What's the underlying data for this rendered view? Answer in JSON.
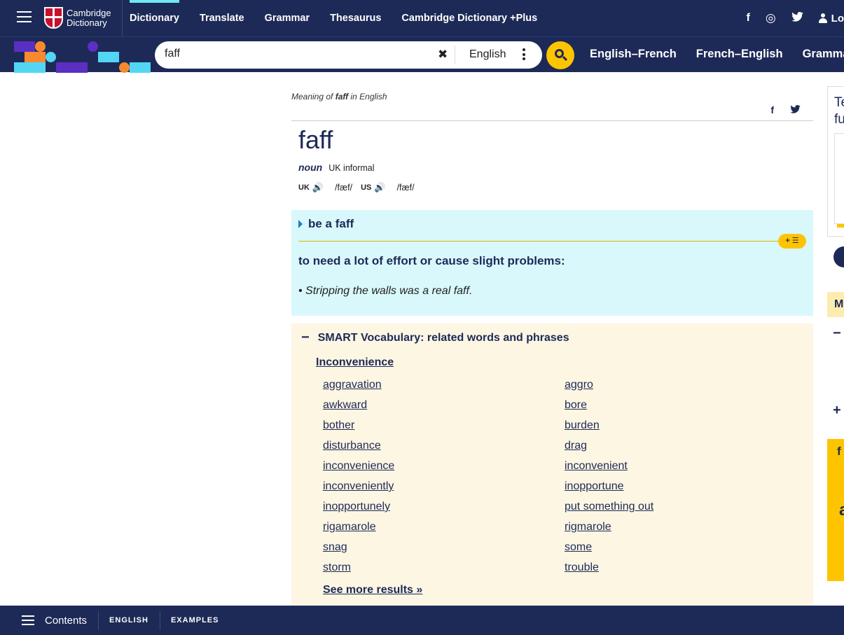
{
  "header": {
    "logo_line1": "Cambridge",
    "logo_line2": "Dictionary",
    "nav": [
      "Dictionary",
      "Translate",
      "Grammar",
      "Thesaurus",
      "Cambridge Dictionary +Plus"
    ],
    "social": [
      "f",
      "◎",
      "🐦"
    ],
    "login": "Lo"
  },
  "search": {
    "value": "faff",
    "language": "English",
    "dict_links": [
      "English–French",
      "French–English",
      "Gramma"
    ]
  },
  "entry": {
    "meaning_prefix": "Meaning of ",
    "meaning_word": "faff",
    "meaning_suffix": " in English",
    "headword": "faff",
    "pos": "noun",
    "labels": "UK informal",
    "uk_label": "UK",
    "uk_ipa": "/fæf/",
    "us_label": "US",
    "us_ipa": "/fæf/",
    "phrase": "be a faff",
    "addlist": "+ ☰",
    "definition": "to need a lot of effort or cause slight problems:",
    "example": "• Stripping the walls was a real faff."
  },
  "smart": {
    "title": "SMART Vocabulary: related words and phrases",
    "topic": "Inconvenience",
    "words": [
      "aggravation",
      "aggro",
      "awkward",
      "bore",
      "bother",
      "burden",
      "disturbance",
      "drag",
      "inconvenience",
      "inconvenient",
      "inconveniently",
      "inopportune",
      "inopportunely",
      "put something out",
      "rigamarole",
      "rigmarole",
      "snag",
      "some",
      "storm",
      "trouble"
    ],
    "see_more": "See more results »"
  },
  "sidebar": {
    "card_t1": "Te",
    "card_t2": "fu",
    "m_label": "M",
    "yellow_f": "f",
    "yellow_a": "a"
  },
  "bottom": {
    "contents": "Contents",
    "links": [
      "ENGLISH",
      "EXAMPLES"
    ]
  }
}
